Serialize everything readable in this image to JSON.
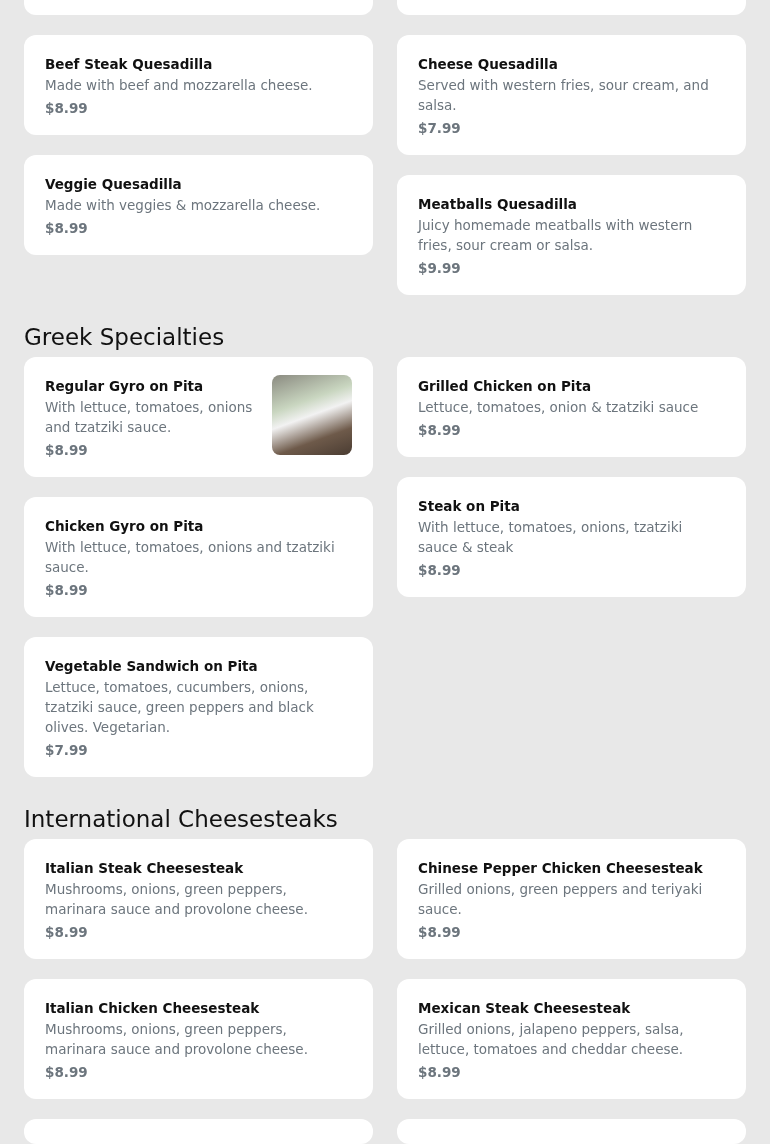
{
  "sections": [
    {
      "columns": [
        [
          {
            "title": "Beef Steak Quesadilla",
            "description": "Made with beef and mozzarella cheese.",
            "price": "$8.99",
            "photo": false
          },
          {
            "title": "Veggie Quesadilla",
            "description": "Made with veggies & mozzarella cheese.",
            "price": "$8.99",
            "photo": false
          }
        ],
        [
          {
            "title": "Cheese Quesadilla",
            "description": "Served with western fries, sour cream, and salsa.",
            "price": "$7.99",
            "photo": false
          },
          {
            "title": "Meatballs Quesadilla",
            "description": "Juicy homemade meatballs with western fries, sour cream or salsa.",
            "price": "$9.99",
            "photo": false
          }
        ]
      ]
    },
    {
      "heading": "Greek Specialties",
      "columns": [
        [
          {
            "title": "Regular Gyro on Pita",
            "description": "With lettuce, tomatoes, onions and tzatziki sauce.",
            "price": "$8.99",
            "photo": true
          },
          {
            "title": "Chicken Gyro on Pita",
            "description": "With lettuce, tomatoes, onions and tzatziki sauce.",
            "price": "$8.99",
            "photo": false
          },
          {
            "title": "Vegetable Sandwich on Pita",
            "description": "Lettuce, tomatoes, cucumbers, onions, tzatziki sauce, green peppers and black olives. Vegetarian.",
            "price": "$7.99",
            "photo": false
          }
        ],
        [
          {
            "title": "Grilled Chicken on Pita",
            "description": "Lettuce, tomatoes, onion & tzatziki sauce",
            "price": "$8.99",
            "photo": false
          },
          {
            "title": "Steak on Pita",
            "description": "With lettuce, tomatoes, onions, tzatziki sauce & steak",
            "price": "$8.99",
            "photo": false
          }
        ]
      ]
    },
    {
      "heading": "International Cheesesteaks",
      "columns": [
        [
          {
            "title": "Italian Steak Cheesesteak",
            "description": "Mushrooms, onions, green peppers, marinara sauce and provolone cheese.",
            "price": "$8.99",
            "photo": false
          },
          {
            "title": "Italian Chicken Cheesesteak",
            "description": "Mushrooms, onions, green peppers, marinara sauce and provolone cheese.",
            "price": "$8.99",
            "photo": false
          }
        ],
        [
          {
            "title": "Chinese Pepper Chicken Cheesesteak",
            "description": "Grilled onions, green peppers and teriyaki sauce.",
            "price": "$8.99",
            "photo": false
          },
          {
            "title": "Mexican Steak Cheesesteak",
            "description": "Grilled onions, jalapeno peppers, salsa, lettuce, tomatoes and cheddar cheese.",
            "price": "$8.99",
            "photo": false
          }
        ]
      ]
    }
  ]
}
